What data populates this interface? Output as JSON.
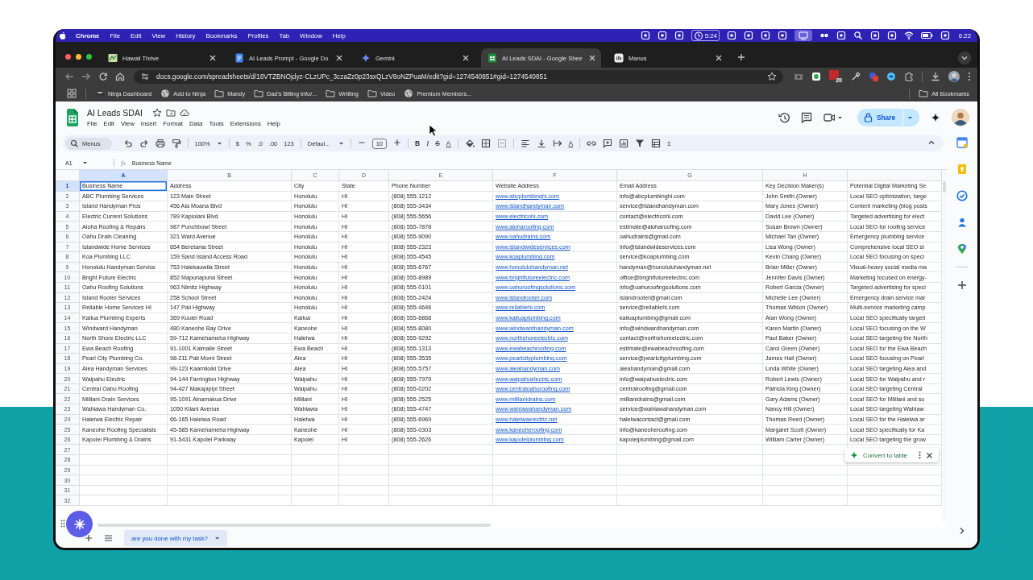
{
  "menubar": {
    "app": "Chrome",
    "menus": [
      "File",
      "Edit",
      "View",
      "History",
      "Bookmarks",
      "Profiles",
      "Tab",
      "Window",
      "Help"
    ],
    "timer": "5:24",
    "clock": "6:22"
  },
  "browser_tabs": [
    {
      "title": "Hawaii Thrive",
      "selected": false
    },
    {
      "title": "AI Leads Prompt - Google Do",
      "selected": false
    },
    {
      "title": "Gemini",
      "selected": false
    },
    {
      "title": "AI Leads SDAI - Google Shee",
      "selected": true
    },
    {
      "title": "Manus",
      "selected": false
    }
  ],
  "address_bar": {
    "url": "docs.google.com/spreadsheets/d/18VTZBNOjdyz-CLzUPc_3czaZz0p23sxQLzV8oNZPuaM/edit?gid=1274540851#gid=1274540851"
  },
  "extension_badge": "20",
  "bookmarks": [
    {
      "label": "Ninja Dashboard",
      "kind": "ninja"
    },
    {
      "label": "Add to Ninja",
      "kind": "site"
    },
    {
      "label": "Mandy",
      "kind": "folder"
    },
    {
      "label": "Dad's Billing Info/...",
      "kind": "folder"
    },
    {
      "label": "Wrtiting",
      "kind": "folder"
    },
    {
      "label": "Video",
      "kind": "folder"
    },
    {
      "label": "Premium Members...",
      "kind": "site"
    }
  ],
  "all_bookmarks": "All Bookmarks",
  "document": {
    "title": "AI Leads SDAI",
    "menus": [
      "File",
      "Edit",
      "View",
      "Insert",
      "Format",
      "Data",
      "Tools",
      "Extensions",
      "Help"
    ],
    "share": "Share"
  },
  "toolbar": {
    "search": "Menus",
    "zoom": "100%",
    "currency": "$",
    "percent": "%",
    "decrease_decimal": ".0",
    "increase_decimal": ".00",
    "number_format": "123",
    "font": "Defaul...",
    "font_size": "10",
    "bold": "B",
    "italic": "I",
    "strikethrough": "S",
    "text_color": "A",
    "text_rotation": "A",
    "functions": "Σ"
  },
  "formula_bar": {
    "cell": "A1",
    "fx": "fx",
    "content": "Business Name"
  },
  "columns": [
    {
      "letter": "A",
      "selected": true,
      "kind": "text"
    },
    {
      "letter": "B",
      "selected": false,
      "kind": "text"
    },
    {
      "letter": "C",
      "selected": false,
      "kind": "text"
    },
    {
      "letter": "D",
      "selected": false,
      "kind": "text"
    },
    {
      "letter": "E",
      "selected": false,
      "kind": "text"
    },
    {
      "letter": "F",
      "selected": false,
      "kind": "link"
    },
    {
      "letter": "G",
      "selected": false,
      "kind": "text"
    },
    {
      "letter": "H",
      "selected": false,
      "kind": "text"
    },
    {
      "selected": false,
      "kind": "text"
    }
  ],
  "rows": [
    {
      "number": "1",
      "selected": true,
      "kind": "labels",
      "cells": [
        "Business Name",
        "Address",
        "City",
        "State",
        "Phone Number",
        "Website Address",
        "Email Address",
        "Key Decision Maker(s)",
        "Potential Digital Marketing Se"
      ]
    },
    {
      "number": "2",
      "selected": false,
      "kind": "record",
      "cells": [
        "ABC Plumbing Services",
        "123 Main Street",
        "Honolulu",
        "HI",
        "(808) 555-1212",
        "www.abcplumbinghi.com",
        "info@abcplumbinghi.com",
        "John Smith (Owner)",
        "Local SEO optimization, targe"
      ]
    },
    {
      "number": "3",
      "selected": false,
      "kind": "record",
      "cells": [
        "Island Handyman Pros",
        "456 Ala Moana Blvd",
        "Honolulu",
        "HI",
        "(808) 555-3434",
        "www.islandhandyman.com",
        "service@islandhandyman.com",
        "Mary Jones (Owner)",
        "Content marketing (blog posts"
      ]
    },
    {
      "number": "4",
      "selected": false,
      "kind": "record",
      "cells": [
        "Electric Current Solutions",
        "789 Kapiolani Blvd",
        "Honolulu",
        "HI",
        "(808) 555-5656",
        "www.electricohi.com",
        "contact@electricohi.com",
        "David Lee (Owner)",
        "Targeted advertising for elect"
      ]
    },
    {
      "number": "5",
      "selected": false,
      "kind": "record",
      "cells": [
        "Aloha Roofing & Repairs",
        "987 Punchbowl Street",
        "Honolulu",
        "HI",
        "(808) 555-7878",
        "www.aloharoofing.com",
        "estimate@aloharoofing.com",
        "Susan Brown (Owner)",
        "Local SEO for roofing service"
      ]
    },
    {
      "number": "6",
      "selected": false,
      "kind": "record",
      "cells": [
        "Oahu Drain Cleaning",
        "321 Ward Avenue",
        "Honolulu",
        "HI",
        "(808) 555-9090",
        "www.oahudrains.com",
        "oahudrains@gmail.com",
        "Michael Tan (Owner)",
        "Emergency plumbing service"
      ]
    },
    {
      "number": "7",
      "selected": false,
      "kind": "record",
      "cells": [
        "Islandwide Home Services",
        "654 Beretania Street",
        "Honolulu",
        "HI",
        "(808) 555-2323",
        "www.islandwideservices.com",
        "info@islandwideservices.com",
        "Lisa Wong (Owner)",
        "Comprehensive local SEO st"
      ]
    },
    {
      "number": "8",
      "selected": false,
      "kind": "record",
      "cells": [
        "Koa Plumbing LLC",
        "159 Sand Island Access Road",
        "Honolulu",
        "HI",
        "(808) 555-4545",
        "www.koaplumbing.com",
        "service@koaplumbing.com",
        "Kevin Chang (Owner)",
        "Local SEO focusing on speci"
      ]
    },
    {
      "number": "9",
      "selected": false,
      "kind": "record",
      "cells": [
        "Honolulu Handyman Service",
        "753 Halekauwila Street",
        "Honolulu",
        "HI",
        "(808) 555-6767",
        "www.honoluluhandyman.net",
        "handyman@honoluluhandyman.net",
        "Brian Miller (Owner)",
        "Visual-heavy social media ma"
      ]
    },
    {
      "number": "10",
      "selected": false,
      "kind": "record",
      "cells": [
        "Bright Future Electric",
        "852 Mapunapuna Street",
        "Honolulu",
        "HI",
        "(808) 555-8989",
        "www.brightfutureelectric.com",
        "office@brightfutureelectric.com",
        "Jennifer Davis (Owner)",
        "Marketing focused on energy-"
      ]
    },
    {
      "number": "11",
      "selected": false,
      "kind": "record",
      "cells": [
        "Oahu Roofing Solutions",
        "963 Nimitz Highway",
        "Honolulu",
        "HI",
        "(808) 555-0101",
        "www.oahuroofingsolutions.com",
        "info@oahuroofingsolutions.com",
        "Robert Garcia (Owner)",
        "Targeted advertising for speci"
      ]
    },
    {
      "number": "12",
      "selected": false,
      "kind": "record",
      "cells": [
        "Island Rooter Services",
        "258 School Street",
        "Honolulu",
        "HI",
        "(808) 555-2424",
        "www.islandrooter.com",
        "islandrooter@gmail.com",
        "Michelle Lee (Owner)",
        "Emergency drain service mar"
      ]
    },
    {
      "number": "13",
      "selected": false,
      "kind": "record",
      "cells": [
        "Reliable Home Services HI",
        "147 Pali Highway",
        "Honolulu",
        "HI",
        "(808) 555-4646",
        "www.reliablehi.com",
        "service@reliablehi.com",
        "Thomas Wilson (Owner)",
        "Multi-service marketing camp"
      ]
    },
    {
      "number": "14",
      "selected": false,
      "kind": "record",
      "cells": [
        "Kailua Plumbing Experts",
        "369 Kuulei Road",
        "Kailua",
        "HI",
        "(808) 555-6868",
        "www.kailuaplumbing.com",
        "kailuaplumbing@gmail.com",
        "Alan Wong (Owner)",
        "Local SEO specifically targeti"
      ]
    },
    {
      "number": "15",
      "selected": false,
      "kind": "record",
      "cells": [
        "Windward Handyman",
        "480 Kaneohe Bay Drive",
        "Kaneohe",
        "HI",
        "(808) 555-8080",
        "www.windwardhandyman.com",
        "info@windwardhandyman.com",
        "Karen Martin (Owner)",
        "Local SEO focusing on the W"
      ]
    },
    {
      "number": "16",
      "selected": false,
      "kind": "record",
      "cells": [
        "North Shore Electric LLC",
        "59-712 Kamehameha Highway",
        "Haleiwa",
        "HI",
        "(808) 555-9292",
        "www.northshoreelectric.com",
        "contact@northshoreelectric.com",
        "Paul Baker (Owner)",
        "Local SEO targeting the North"
      ]
    },
    {
      "number": "17",
      "selected": false,
      "kind": "record",
      "cells": [
        "Ewa Beach Roofing",
        "91-1001 Kaimalie Street",
        "Ewa Beach",
        "HI",
        "(808) 555-1313",
        "www.ewabeachroofing.com",
        "estimate@ewabeachroofing.com",
        "Carol Green (Owner)",
        "Local SEO for the Ewa Beach"
      ]
    },
    {
      "number": "18",
      "selected": false,
      "kind": "record",
      "cells": [
        "Pearl City Plumbing Co.",
        "98-211 Pali Momi Street",
        "Aiea",
        "HI",
        "(808) 555-3535",
        "www.pearlcityplumbing.com",
        "service@pearlcityplumbing.com",
        "James Hall (Owner)",
        "Local SEO focusing on Pearl"
      ]
    },
    {
      "number": "19",
      "selected": false,
      "kind": "record",
      "cells": [
        "Aiea Handyman Services",
        "99-123 Kaamiloiki Drive",
        "Aiea",
        "HI",
        "(808) 555-5757",
        "www.aieahandyman.com",
        "aieahandyman@gmail.com",
        "Linda White (Owner)",
        "Local SEO targeting Aiea and"
      ]
    },
    {
      "number": "20",
      "selected": false,
      "kind": "record",
      "cells": [
        "Waipahu Electric",
        "94-144 Farrington Highway",
        "Waipahu",
        "HI",
        "(808) 555-7979",
        "www.waipahuelectric.com",
        "info@waipahuelectric.com",
        "Robert Lewis (Owner)",
        "Local SEO for Waipahu and r"
      ]
    },
    {
      "number": "21",
      "selected": false,
      "kind": "record",
      "cells": [
        "Central Oahu Roofing",
        "94-427 Makapipipi Street",
        "Waipahu",
        "HI",
        "(808) 555-0202",
        "www.centraloahuroofing.com",
        "centralroofing@gmail.com",
        "Patricia King (Owner)",
        "Local SEO targeting Central"
      ]
    },
    {
      "number": "22",
      "selected": false,
      "kind": "record",
      "cells": [
        "Mililani Drain Services",
        "95-1091 Ainamakua Drive",
        "Mililani",
        "HI",
        "(808) 555-2525",
        "www.mililanidrains.com",
        "mililanidrains@gmail.com",
        "Gary Adams (Owner)",
        "Local SEO for Mililani and su"
      ]
    },
    {
      "number": "23",
      "selected": false,
      "kind": "record",
      "cells": [
        "Wahiawa Handyman Co.",
        "1050 Kilani Avenue",
        "Wahiawa",
        "HI",
        "(808) 555-4747",
        "www.wahiawahandyman.com",
        "service@wahiawahandyman.com",
        "Nancy Hill (Owner)",
        "Local SEO targeting Wahiaw"
      ]
    },
    {
      "number": "24",
      "selected": false,
      "kind": "record",
      "cells": [
        "Haleiwa Electric Repair",
        "66-165 Haleiwa Road",
        "Haleiwa",
        "HI",
        "(808) 555-6969",
        "www.haleiwaelectric.net",
        "haleiwacontact@gmail.com",
        "Thomas Reed (Owner)",
        "Local SEO for the Haleiwa ar"
      ]
    },
    {
      "number": "25",
      "selected": false,
      "kind": "record",
      "cells": [
        "Kaneohe Roofing Specialists",
        "45-585 Kamehameha Highway",
        "Kaneohe",
        "HI",
        "(808) 555-0303",
        "www.kaneoheroofing.com",
        "info@kaneoheroofing.com",
        "Margaret Scott (Owner)",
        "Local SEO specifically for Ka"
      ]
    },
    {
      "number": "26",
      "selected": false,
      "kind": "record",
      "cells": [
        "Kapolei Plumbing & Drains",
        "91-5431 Kapolei Parkway",
        "Kapolei",
        "HI",
        "(808) 555-2626",
        "www.kapoleiplumbing.com",
        "kapoleiplumbing@gmail.com",
        "William Carter (Owner)",
        "Local SEO targeting the grow"
      ]
    }
  ],
  "empty_rows": [
    "27",
    "28",
    "29",
    "30",
    "31",
    "32"
  ],
  "chip": {
    "label": "Convert to table"
  },
  "sheet_tabs": [
    {
      "label": "are you done with my task?",
      "selected": true
    }
  ]
}
